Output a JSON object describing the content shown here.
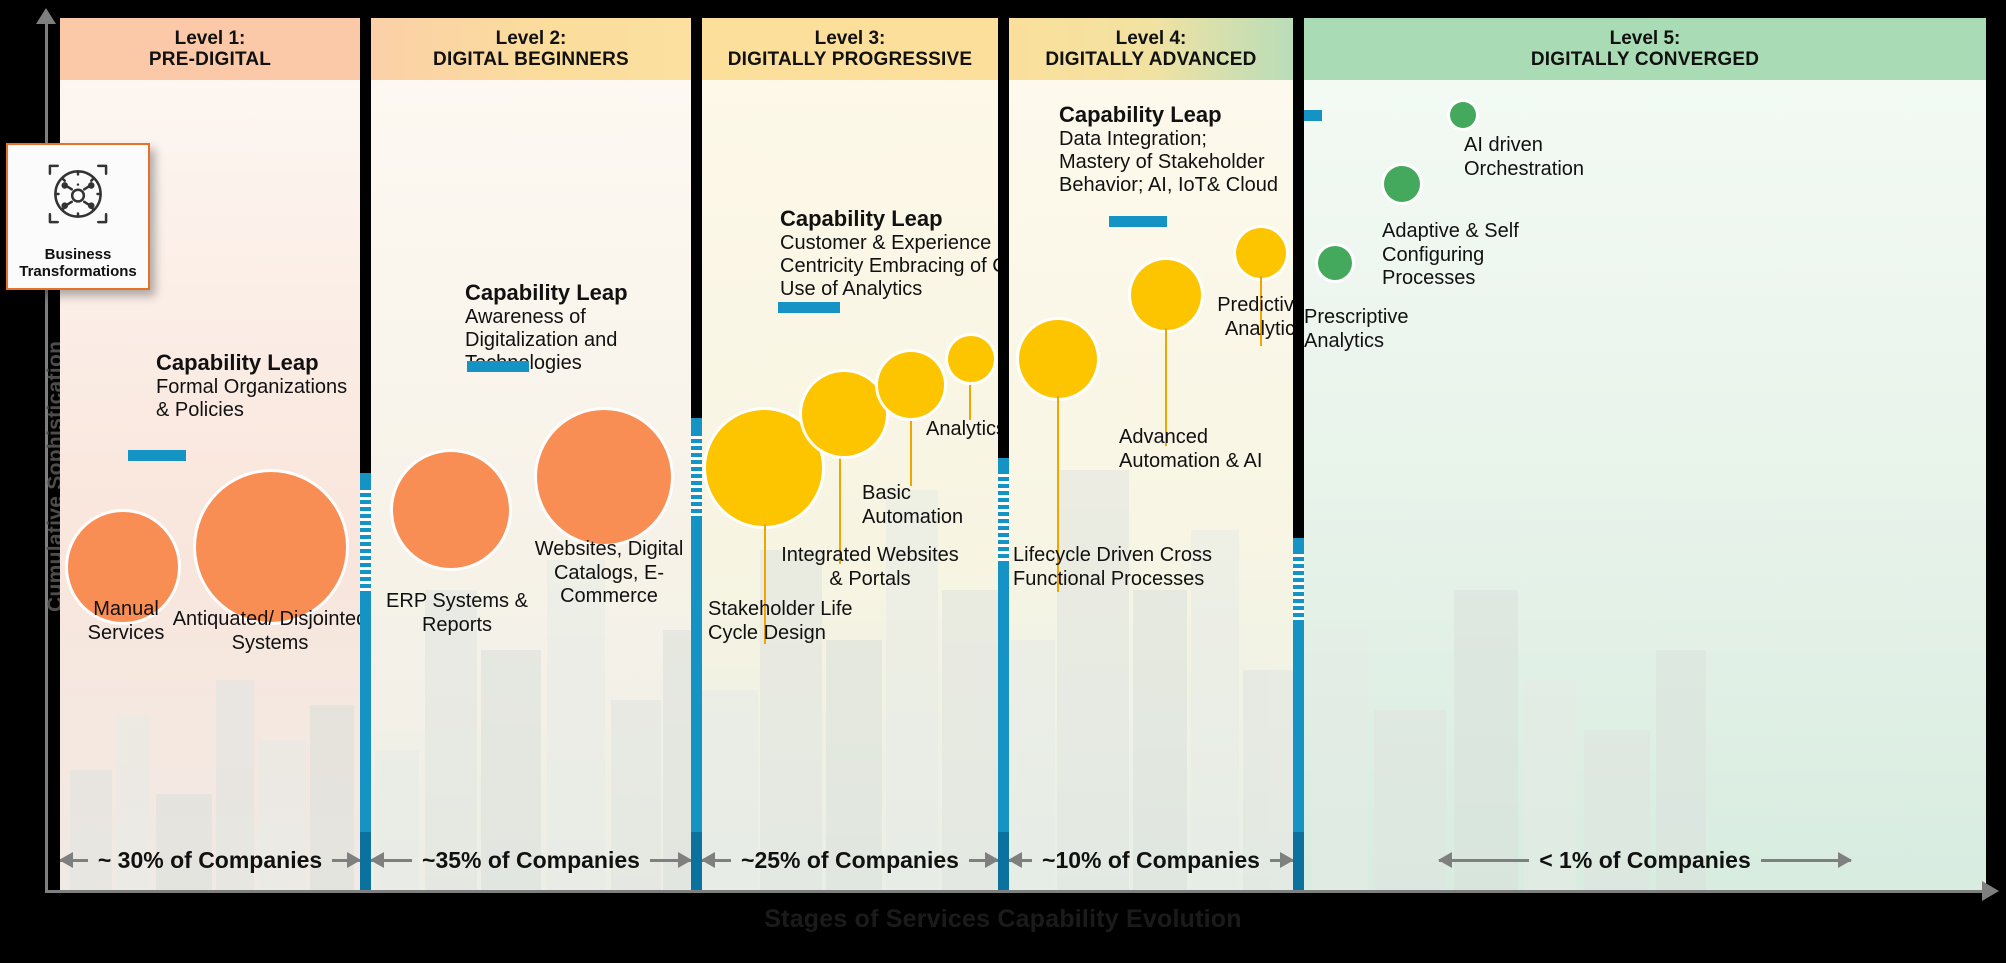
{
  "axes": {
    "y_label": "Cumulative Sophistication",
    "x_label": "Stages of Services Capability Evolution"
  },
  "badge": {
    "icon": "business-transformation-gear-icon",
    "line1": "Business",
    "line2": "Transformations",
    "border_color": "#e8712a"
  },
  "palette": {
    "blue_marker": "#1593c4",
    "orange_bubble": "#f98e55",
    "yellow_bubble": "#fdc500",
    "green_bubble": "#44a95c",
    "axis_gray": "#7f7f7f"
  },
  "chart_data": {
    "type": "bar",
    "title": "Stages of Services Capability Evolution",
    "xlabel": "Stages of Services Capability Evolution",
    "ylabel": "Cumulative Sophistication",
    "categories": [
      "Level 1: PRE-DIGITAL",
      "Level 2: DIGITAL BEGINNERS",
      "Level 3: DIGITALLY PROGRESSIVE",
      "Level 4: DIGITALLY ADVANCED",
      "Level 5: DIGITALLY CONVERGED"
    ],
    "series": [
      {
        "name": "Share of Companies (%)",
        "values": [
          30,
          35,
          25,
          10,
          0.5
        ]
      }
    ],
    "value_labels": [
      "~ 30% of Companies",
      "~35% of Companies",
      "~25% of Companies",
      "~10% of Companies",
      "< 1% of Companies"
    ]
  },
  "levels": [
    {
      "id": "level-1",
      "head_line1": "Level 1:",
      "head_line2": "PRE-DIGITAL",
      "head_bg": "#fbc8a8",
      "body_bg": "linear-gradient(180deg,#fdf6f1 0%,#f9e6dc 55%,#f1e9e4 100%)",
      "pct_label": "~ 30% of Companies",
      "leap": {
        "title": "Capability Leap",
        "desc": "Formal Organizations & Policies"
      },
      "bubbles": [
        {
          "label": "Manual Services",
          "color": "#f98e55"
        },
        {
          "label": "Antiquated/ Disjointed Systems",
          "color": "#f98e55"
        }
      ]
    },
    {
      "id": "level-2",
      "head_line1": "Level 2:",
      "head_line2": "DIGITAL BEGINNERS",
      "head_bg": "linear-gradient(90deg,#fbd0a8 0%,#fbdd9c 55%,#fbe0a0 100%)",
      "body_bg": "linear-gradient(180deg,#fdf8f1 0%,#f6f2e8 60%,#edeee6 100%)",
      "pct_label": "~35% of Companies",
      "leap": {
        "title": "Capability Leap",
        "desc": "Awareness of Digitalization and Technologies"
      },
      "bubbles": [
        {
          "label": "ERP Systems & Reports",
          "color": "#f98e55"
        },
        {
          "label": "Websites, Digital Catalogs, E-Commerce",
          "color": "#f98e55"
        }
      ]
    },
    {
      "id": "level-3",
      "head_line1": "Level 3:",
      "head_line2": "DIGITALLY PROGRESSIVE",
      "head_bg": "#fbdf9b",
      "body_bg": "linear-gradient(180deg,#fdf8e8 0%,#f7f4e2 60%,#e9eee6 100%)",
      "pct_label": "~25% of Companies",
      "leap": {
        "title": "Capability Leap",
        "desc": "Customer & Experience Centricity Embracing of Cloud Use of Analytics"
      },
      "bubbles": [
        {
          "label": "Stakeholder Life Cycle Design",
          "color": "#fdc500"
        },
        {
          "label": "Integrated Websites & Portals",
          "color": "#fdc500"
        },
        {
          "label": "Basic Automation",
          "color": "#fdc500"
        },
        {
          "label": "Analytics",
          "color": "#fdc500"
        }
      ]
    },
    {
      "id": "level-4",
      "head_line1": "Level 4:",
      "head_line2": "DIGITALLY ADVANCED",
      "head_bg": "linear-gradient(90deg,#fbdf9b 0%,#f2e2a2 50%,#b9ddb9 100%)",
      "body_bg": "linear-gradient(180deg,#fdf9ec 0%,#f8f5e4 55%,#e7efe7 100%)",
      "pct_label": "~10% of Companies",
      "leap": {
        "title": "Capability Leap",
        "desc": "Data Integration; Mastery of Stakeholder Behavior; AI, IoT& Cloud"
      },
      "bubbles": [
        {
          "label": "Lifecycle Driven Cross Functional Processes",
          "color": "#fdc500"
        },
        {
          "label": "Advanced Automation & AI",
          "color": "#fdc500"
        },
        {
          "label": "Predictive Analytics",
          "color": "#fdc500"
        }
      ]
    },
    {
      "id": "level-5",
      "head_line1": "Level 5:",
      "head_line2": "DIGITALLY CONVERGED",
      "head_bg": "#a9dcb4",
      "body_bg": "linear-gradient(180deg,#f3faf4 0%,#e8f3ea 50%,#d8ece0 100%)",
      "pct_label": "< 1% of Companies",
      "leap": null,
      "bubbles": [
        {
          "label": "Prescriptive Analytics",
          "color": "#44a95c"
        },
        {
          "label": "Adaptive & Self Configuring Processes",
          "color": "#44a95c"
        },
        {
          "label": "AI driven Orchestration",
          "color": "#44a95c"
        }
      ]
    }
  ]
}
